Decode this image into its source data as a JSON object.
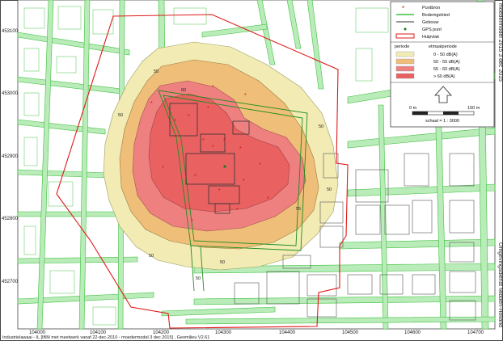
{
  "colors": {
    "background": "#ffffff",
    "roads": "#b9ecb9",
    "road_edge": "#3fbf3f",
    "zone_0_50": "#f2ecb4",
    "zone_50_55": "#efbe78",
    "zone_55_60": "#ee8080",
    "zone_60": "#e96161",
    "boundary": "#e01818",
    "building": "#333333"
  },
  "side_title_right": "moedermodel 2015 3 dec 2015",
  "side_title_bottom": "Omgevingsdienst Midden-Holland",
  "footer": "Industrielawaai - IL [IBM met meetwerk vanaf 22-dec-2010 - moedermodel 3 dec 2015] , Geomilieu V2.61",
  "legend": {
    "items": [
      {
        "label": "Puntbron",
        "icon": "asterisk-icon"
      },
      {
        "label": "Bodemgebied",
        "icon": "green-line-icon"
      },
      {
        "label": "Gebouw",
        "icon": "building-line-icon"
      },
      {
        "label": "GPS punt",
        "icon": "dot-icon"
      },
      {
        "label": "Hulpvlak",
        "icon": "red-rect-icon"
      }
    ],
    "header_col1": "periode",
    "header_col2": "etmaalperiode",
    "classes": [
      {
        "label": "0 - 50 dB(A)",
        "color": "#f2ecb4"
      },
      {
        "label": "50 - 55 dB(A)",
        "color": "#efbe78"
      },
      {
        "label": "55 - 60 dB(A)",
        "color": "#ee8080"
      },
      {
        "label": "> 60 dB(A)",
        "color": "#e96161"
      }
    ],
    "scale_left": "0 m",
    "scale_right": "100 m",
    "scale_text": "schaal = 1 : 3000"
  },
  "x_ticks": [
    "104000",
    "104100",
    "104200",
    "104300",
    "104400",
    "104500",
    "104600",
    "104700"
  ],
  "y_ticks": [
    "453100",
    "453000",
    "452900",
    "452800",
    "452700"
  ],
  "contour_labels": [
    "50",
    "50",
    "50",
    "55",
    "60",
    "55",
    "50",
    "50",
    "50"
  ]
}
